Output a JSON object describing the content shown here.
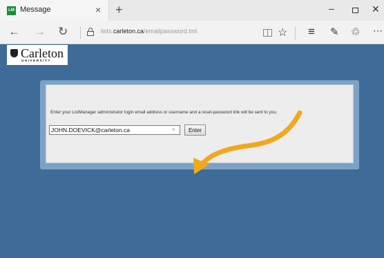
{
  "browser": {
    "tab_title": "Message",
    "favicon_text": "LM",
    "tab_close": "×",
    "new_tab": "+",
    "window_min": "–",
    "window_close": "✕",
    "nav_back": "←",
    "nav_forward": "→",
    "nav_refresh": "↻",
    "url_prefix": "lists.",
    "url_domain": "carleton.ca",
    "url_path": "/emailpassword.tml",
    "favorite_icon": "☆",
    "hub_icon": "≡",
    "note_icon": "✎",
    "share_icon": "♲",
    "more_icon": "⋯"
  },
  "logo": {
    "name": "Carleton",
    "subtitle": "UNIVERSITY"
  },
  "form": {
    "instruction": "Enter your ListManager administrator login email address or username and a reset-password link will be sent to you.",
    "email_value": "JOHN.DOEVICK@carleton.ca",
    "clear_icon": "×",
    "enter_label": "Enter"
  },
  "colors": {
    "page_background": "#3e6b98",
    "annotation_arrow": "#f2a81d"
  }
}
